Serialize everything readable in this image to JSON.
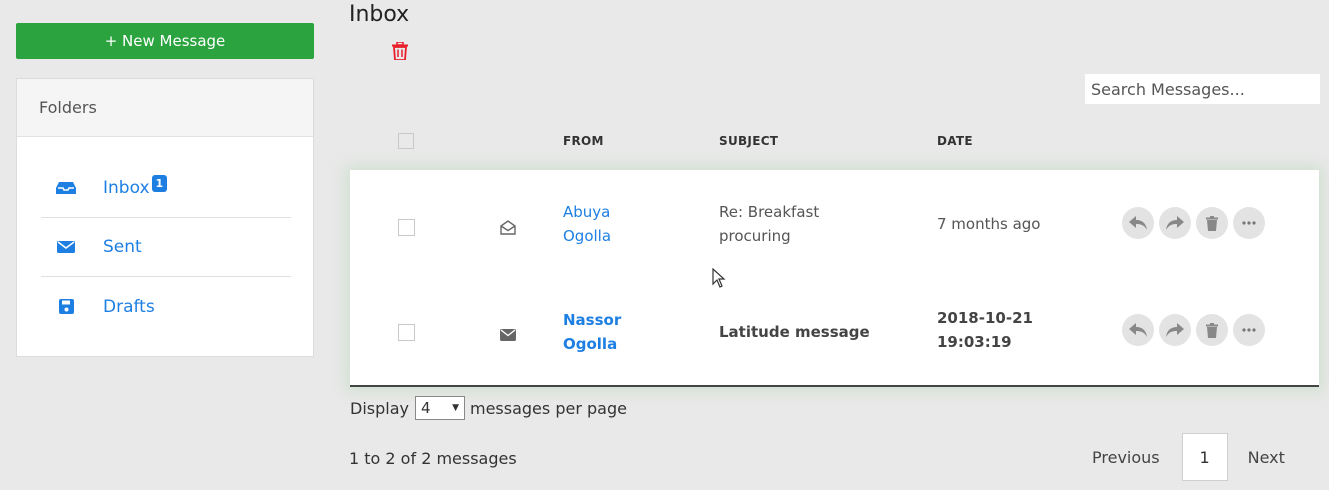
{
  "compose": {
    "label": "+ New Message"
  },
  "folders": {
    "heading": "Folders",
    "items": [
      {
        "label": "Inbox",
        "icon": "inbox-icon",
        "badge": "1"
      },
      {
        "label": "Sent",
        "icon": "envelope-icon"
      },
      {
        "label": "Drafts",
        "icon": "save-icon"
      }
    ]
  },
  "page": {
    "title": "Inbox"
  },
  "search": {
    "placeholder": "Search Messages..."
  },
  "table": {
    "headers": {
      "from": "FROM",
      "subject": "SUBJECT",
      "date": "DATE"
    },
    "rows": [
      {
        "from_first": "Abuya",
        "from_last": "Ogolla",
        "subject_1": "Re: Breakfast",
        "subject_2": "procuring",
        "date_1": "7 months ago",
        "date_2": "",
        "read": true
      },
      {
        "from_first": "Nassor",
        "from_last": "Ogolla",
        "subject_1": "Latitude message",
        "subject_2": "",
        "date_1": "2018-10-21",
        "date_2": "19:03:19",
        "read": false
      }
    ]
  },
  "display": {
    "prefix": "Display",
    "value": "4",
    "suffix": "messages per page"
  },
  "summary": "1 to 2 of 2 messages",
  "pagination": {
    "previous": "Previous",
    "current": "1",
    "next": "Next"
  },
  "colors": {
    "accent": "#1e7fe3",
    "compose": "#2ba33f",
    "delete": "#e8202a"
  }
}
